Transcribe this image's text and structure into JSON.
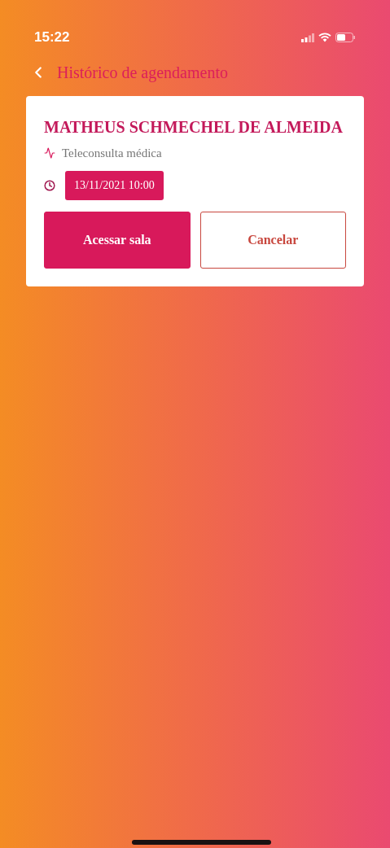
{
  "status_bar": {
    "time": "15:22"
  },
  "header": {
    "title": "Histórico de agendamento"
  },
  "appointment": {
    "name": "MATHEUS SCHMECHEL DE ALMEIDA",
    "service": "Teleconsulta médica",
    "datetime": "13/11/2021 10:00",
    "buttons": [
      {
        "label": "Acessar sala",
        "kind": "primary"
      },
      {
        "label": "Cancelar",
        "kind": "outline"
      }
    ]
  }
}
